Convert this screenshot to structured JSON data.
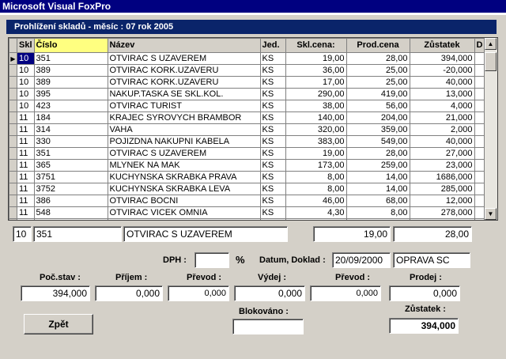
{
  "app": {
    "title": "Microsoft Visual FoxPro"
  },
  "window": {
    "title": "Prohlížení skladů  -  měsíc : 07  rok 2005"
  },
  "grid": {
    "columns": [
      "Skl",
      "Číslo",
      "Název",
      "Jed.",
      "Skl.cena:",
      "Prod.cena",
      "Zůstatek",
      "D"
    ],
    "rows": [
      [
        "10",
        "351",
        "OTVIRAC S UZAVEREM",
        "KS",
        "19,00",
        "28,00",
        "394,000"
      ],
      [
        "10",
        "389",
        "OTVIRAC KORK.UZAVERU",
        "KS",
        "36,00",
        "25,00",
        "-20,000"
      ],
      [
        "10",
        "389",
        "OTVIRAC KORK.UZAVERU",
        "KS",
        "17,00",
        "25,00",
        "40,000"
      ],
      [
        "10",
        "395",
        "NAKUP.TASKA SE SKL.KOL.",
        "KS",
        "290,00",
        "419,00",
        "13,000"
      ],
      [
        "10",
        "423",
        "OTVIRAC TURIST",
        "KS",
        "38,00",
        "56,00",
        "4,000"
      ],
      [
        "11",
        "184",
        "KRAJEC SYROVYCH BRAMBOR",
        "KS",
        "140,00",
        "204,00",
        "21,000"
      ],
      [
        "11",
        "314",
        "VAHA",
        "KS",
        "320,00",
        "359,00",
        "2,000"
      ],
      [
        "11",
        "330",
        "POJIZDNA NAKUPNI KABELA",
        "KS",
        "383,00",
        "549,00",
        "40,000"
      ],
      [
        "11",
        "351",
        "OTVIRAC S UZAVEREM",
        "KS",
        "19,00",
        "28,00",
        "27,000"
      ],
      [
        "11",
        "365",
        "MLYNEK NA MAK",
        "KS",
        "173,00",
        "259,00",
        "23,000"
      ],
      [
        "11",
        "3751",
        "KUCHYNSKA SKRABKA PRAVA",
        "KS",
        "8,00",
        "14,00",
        "1686,000"
      ],
      [
        "11",
        "3752",
        "KUCHYNSKA SKRABKA LEVA",
        "KS",
        "8,00",
        "14,00",
        "285,000"
      ],
      [
        "11",
        "386",
        "OTVIRAC BOCNI",
        "KS",
        "46,00",
        "68,00",
        "12,000"
      ],
      [
        "11",
        "548",
        "OTVIRAC VICEK OMNIA",
        "KS",
        "4,30",
        "8,00",
        "278,000"
      ],
      [
        "",
        "",
        "",
        "KS",
        "",
        "",
        ""
      ]
    ]
  },
  "detail": {
    "skl": "10",
    "cislo": "351",
    "nazev": "OTVIRAC S UZAVEREM",
    "skl_cena": "19,00",
    "prod_cena": "28,00",
    "dph_label": "DPH :",
    "dph_value": "",
    "percent": "%",
    "datum_label": "Datum, Doklad :",
    "datum_value": "20/09/2000",
    "doklad_value": "OPRAVA SC"
  },
  "stats": {
    "poc_stav_label": "Poč.stav :",
    "poc_stav": "394,000",
    "prijem_label": "Příjem :",
    "prijem": "0,000",
    "prevod1_label": "Převod :",
    "prevod1": "0,000",
    "vydej_label": "Výdej :",
    "vydej": "0,000",
    "prevod2_label": "Převod :",
    "prevod2": "0,000",
    "prodej_label": "Prodej :",
    "prodej": "0,000",
    "blokovano_label": "Blokováno :",
    "blokovano": "",
    "zustatek_label": "Zůstatek :",
    "zustatek": "394,000"
  },
  "buttons": {
    "back": "Zpět"
  },
  "icons": {
    "row_pointer": "row-pointer-icon",
    "scroll_up": "scroll-up-icon",
    "scroll_down": "scroll-down-icon"
  }
}
